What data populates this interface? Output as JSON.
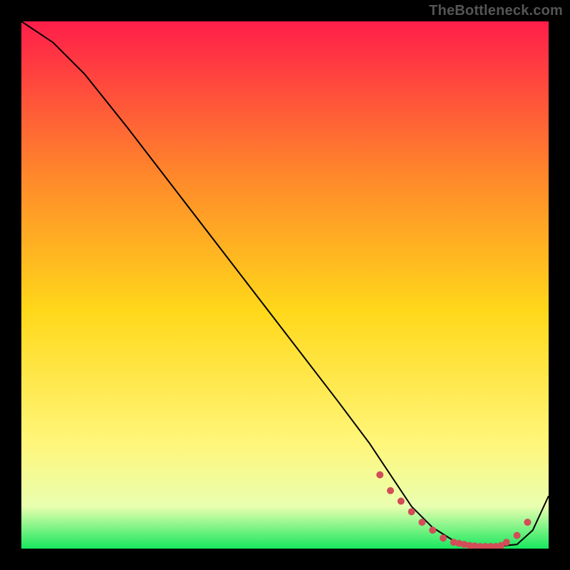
{
  "watermark": "TheBottleneck.com",
  "colors": {
    "background": "#000000",
    "gradient_top": "#ff1e4a",
    "gradient_mid_upper": "#ff8a2a",
    "gradient_mid": "#ffd81a",
    "gradient_mid_lower": "#fff67a",
    "gradient_low": "#e9ffb0",
    "gradient_bottom": "#17e85e",
    "curve": "#000000",
    "markers": "#d24d57"
  },
  "chart_data": {
    "type": "line",
    "title": "",
    "xlabel": "",
    "ylabel": "",
    "xlim": [
      0,
      100
    ],
    "ylim": [
      0,
      100
    ],
    "curve": {
      "x": [
        0,
        6,
        12,
        20,
        30,
        40,
        50,
        60,
        66,
        70,
        74,
        78,
        82,
        86,
        90,
        94,
        97,
        100
      ],
      "y": [
        100,
        96,
        90,
        80,
        67,
        54,
        41,
        28,
        20,
        14,
        8,
        4,
        1.5,
        0.5,
        0.4,
        0.8,
        3.5,
        10
      ]
    },
    "markers": {
      "x": [
        68,
        70,
        72,
        74,
        76,
        78,
        80,
        82,
        83,
        84,
        85,
        86,
        87,
        88,
        89,
        90,
        91,
        92,
        94,
        96
      ],
      "y": [
        14,
        11,
        9,
        7,
        5,
        3.5,
        2,
        1.2,
        1,
        0.8,
        0.6,
        0.5,
        0.4,
        0.4,
        0.4,
        0.4,
        0.6,
        1.2,
        2.5,
        5
      ]
    }
  }
}
